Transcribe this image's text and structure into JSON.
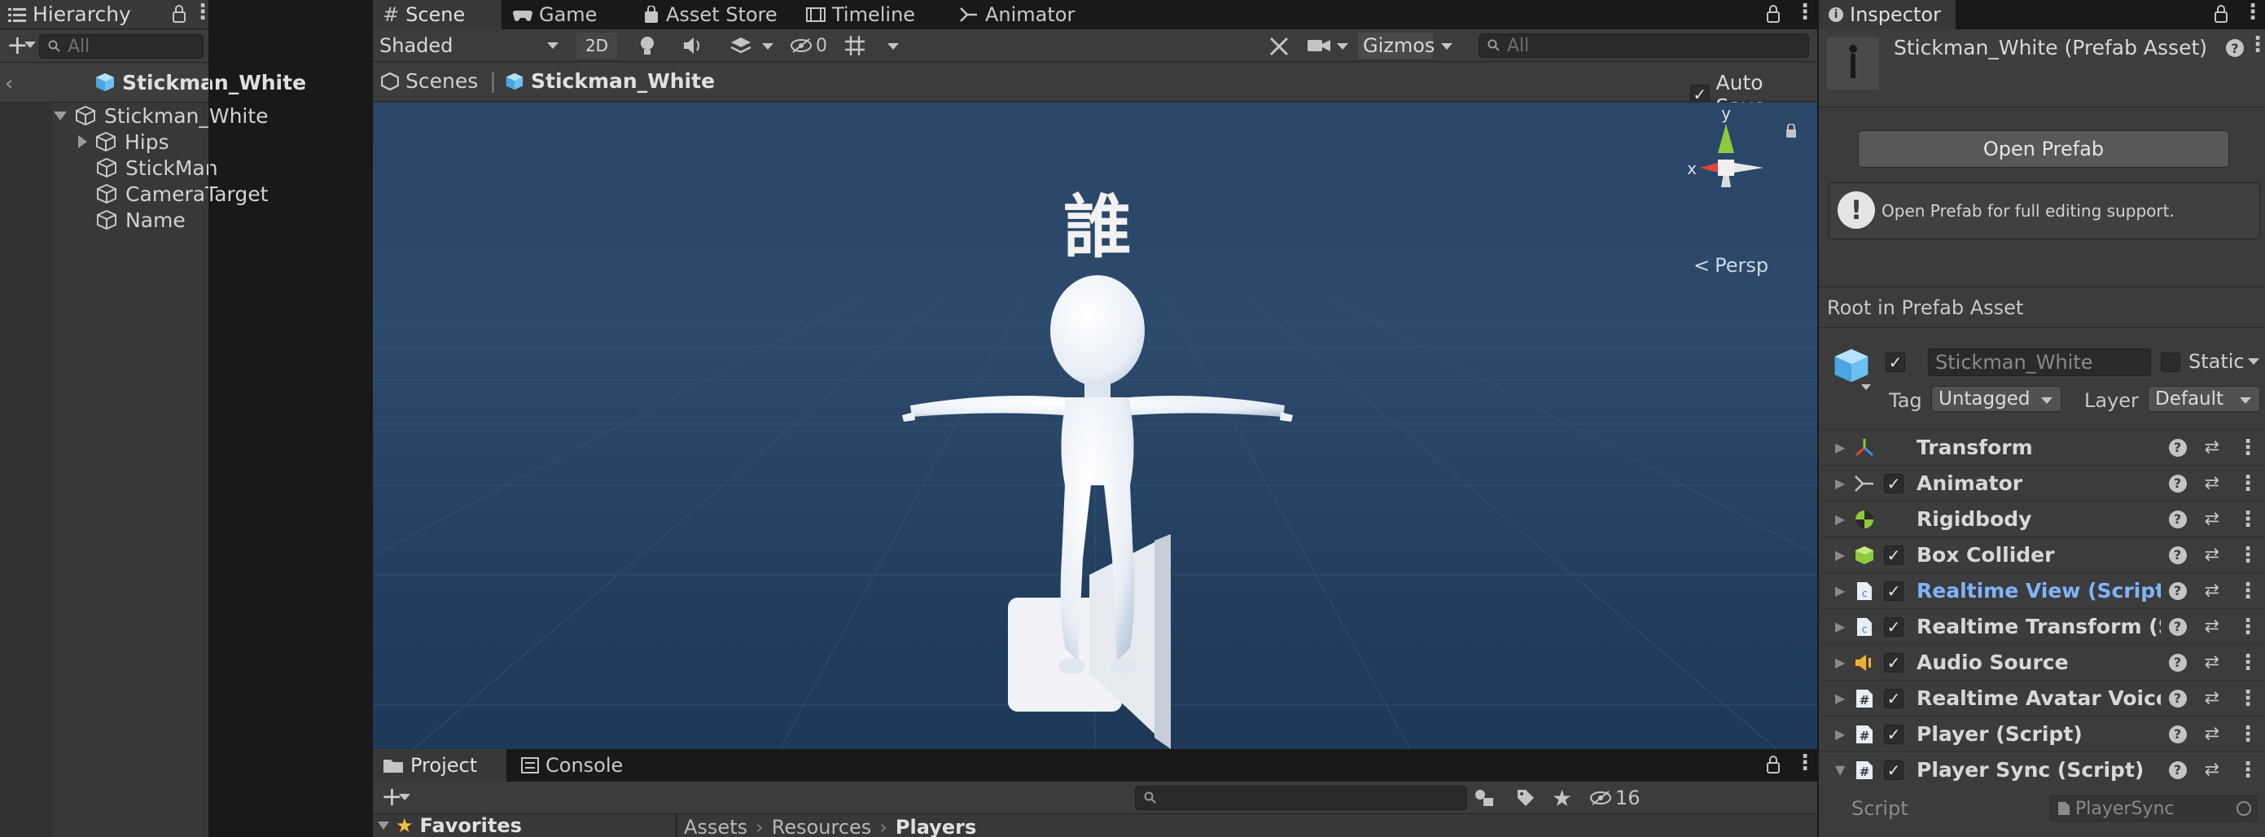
{
  "hierarchy": {
    "tab_label": "Hierarchy",
    "search_placeholder": "All",
    "prefab_header": "Stickman_White",
    "tree": [
      {
        "label": "Stickman_White"
      },
      {
        "label": "Hips"
      },
      {
        "label": "StickMan"
      },
      {
        "label": "CameraTarget"
      },
      {
        "label": "Name"
      }
    ]
  },
  "scene_tabs": [
    {
      "label": "Scene",
      "icon": "hash-icon"
    },
    {
      "label": "Game",
      "icon": "gamepad-icon"
    },
    {
      "label": "Asset Store",
      "icon": "bag-icon"
    },
    {
      "label": "Timeline",
      "icon": "film-icon"
    },
    {
      "label": "Animator",
      "icon": "animator-icon"
    }
  ],
  "scene_toolbar": {
    "shading_mode": "Shaded",
    "mode_2d": "2D",
    "hidden_count": "0",
    "gizmos_label": "Gizmos",
    "search_placeholder": "All"
  },
  "breadcrumb": {
    "root": "Scenes",
    "current": "Stickman_White",
    "auto_save_label": "Auto Save"
  },
  "viewport": {
    "name_tag_text": "誰",
    "persp_label": "Persp",
    "axis_x": "x",
    "axis_y": "y"
  },
  "project": {
    "tabs": [
      "Project",
      "Console"
    ],
    "favorites_label": "Favorites",
    "path": [
      "Assets",
      "Resources",
      "Players"
    ],
    "hidden_count": "16"
  },
  "inspector": {
    "tab_label": "Inspector",
    "title": "Stickman_White (Prefab Asset)",
    "open_prefab_label": "Open Prefab",
    "info_text": "Open Prefab for full editing support.",
    "root_label": "Root in Prefab Asset",
    "object_name": "Stickman_White",
    "static_label": "Static",
    "tag_label": "Tag",
    "tag_value": "Untagged",
    "layer_label": "Layer",
    "layer_value": "Default",
    "components": [
      {
        "name": "Transform",
        "icon": "transform-icon",
        "checkbox": false,
        "highlight": false
      },
      {
        "name": "Animator",
        "icon": "animator-icon",
        "checkbox": true,
        "highlight": false
      },
      {
        "name": "Rigidbody",
        "icon": "rigidbody-icon",
        "checkbox": false,
        "highlight": false
      },
      {
        "name": "Box Collider",
        "icon": "box-collider-icon",
        "checkbox": true,
        "highlight": false
      },
      {
        "name": "Realtime View (Script)",
        "icon": "script-icon",
        "checkbox": true,
        "highlight": true
      },
      {
        "name": "Realtime Transform (Script)",
        "icon": "script-icon",
        "checkbox": true,
        "highlight": false
      },
      {
        "name": "Audio Source",
        "icon": "audio-source-icon",
        "checkbox": true,
        "highlight": false
      },
      {
        "name": "Realtime Avatar Voice (Script)",
        "icon": "hash-script-icon",
        "checkbox": true,
        "highlight": false
      },
      {
        "name": "Player (Script)",
        "icon": "hash-script-icon",
        "checkbox": true,
        "highlight": false
      },
      {
        "name": "Player Sync (Script)",
        "icon": "hash-script-icon",
        "checkbox": true,
        "highlight": false,
        "expanded": true
      }
    ],
    "script_field_label": "Script",
    "script_field_value": "PlayerSync"
  },
  "colors": {
    "viewport_sky": "#2b4566",
    "viewport_ground": "#1f3a5a",
    "link_blue": "#7fb4ff",
    "panel": "#383838"
  }
}
